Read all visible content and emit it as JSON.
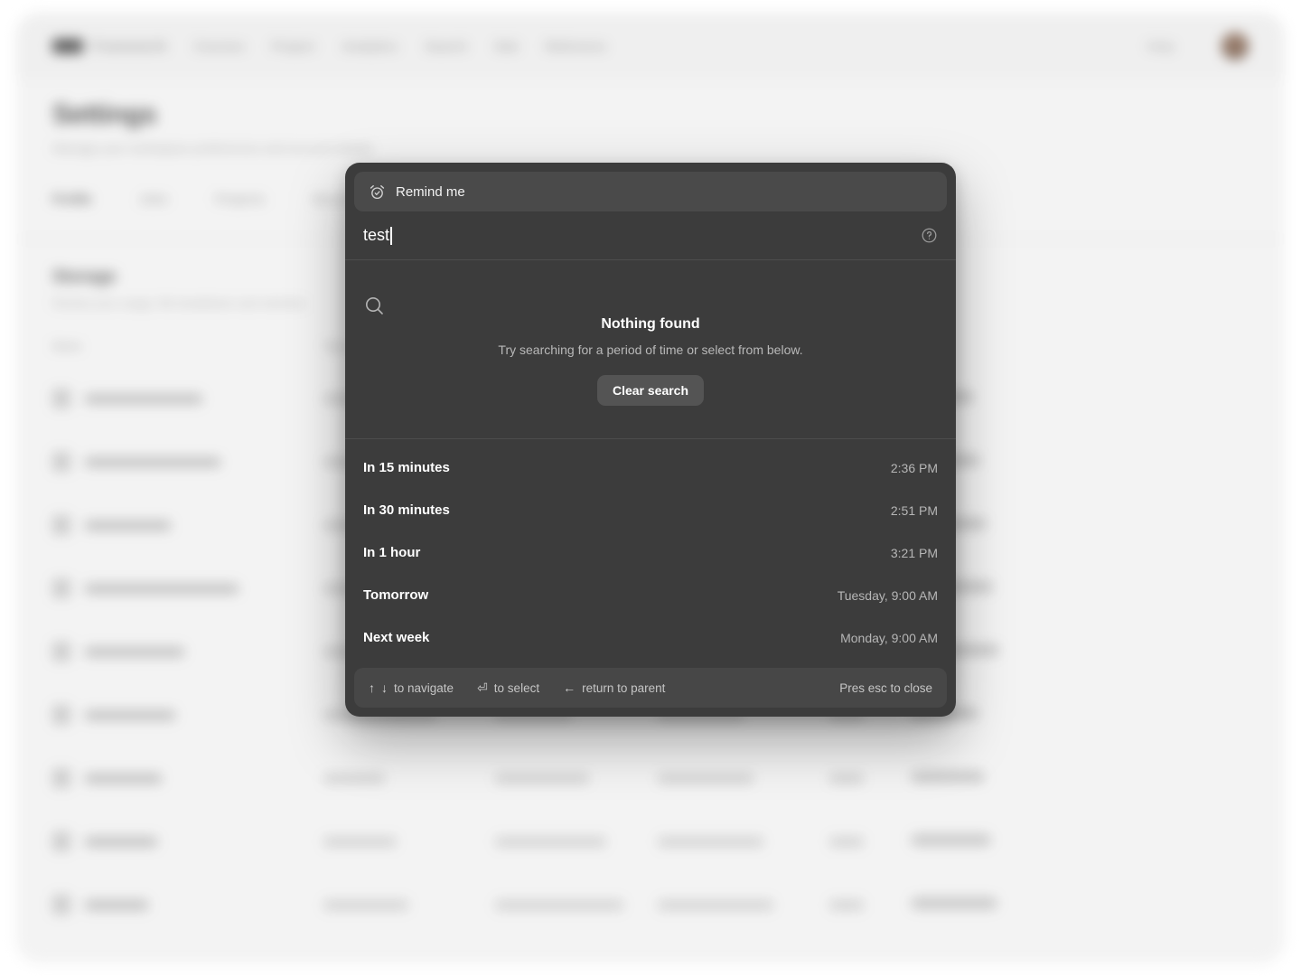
{
  "background": {
    "topbar": {
      "brand": "Framework",
      "nav": [
        "Courses",
        "Project",
        "Analytics",
        "Search",
        "Stat",
        "Reference"
      ],
      "action": "Help",
      "avatar": "user-avatar"
    },
    "page": {
      "title": "Settings",
      "subtitle": "Manage your workspace preferences and account details",
      "tabs": [
        "Profile",
        "Jobs",
        "Projects",
        "Security"
      ],
      "section_title": "Storage",
      "section_subtitle": "Review your usage, file breakdown and retention",
      "table": {
        "columns": [
          "Name",
          "Type",
          "Size",
          "Modified",
          "Role",
          "Status"
        ],
        "rows": [
          {
            "name": "Workspace",
            "type": "",
            "size": "",
            "modified": "",
            "role": "Owner",
            "status": "Active"
          },
          {
            "name": "Marketplace",
            "type": "",
            "size": "",
            "modified": "",
            "role": "Editor",
            "status": "Active"
          },
          {
            "name": "Database",
            "type": "",
            "size": "",
            "modified": "",
            "role": "Viewer",
            "status": "Archived"
          },
          {
            "name": "Documentation",
            "type": "",
            "size": "",
            "modified": "",
            "role": "Owner",
            "status": "Active"
          },
          {
            "name": "Reports",
            "type": "",
            "size": "",
            "modified": "",
            "role": "Editor",
            "status": "Pending"
          },
          {
            "name": "Assets",
            "type": "",
            "size": "",
            "modified": "",
            "role": "Viewer",
            "status": "Active"
          },
          {
            "name": "Images",
            "type": "",
            "size": "",
            "modified": "",
            "role": "Owner",
            "status": "Archived"
          },
          {
            "name": "Videos",
            "type": "",
            "size": "",
            "modified": "",
            "role": "Editor",
            "status": "Active"
          },
          {
            "name": "Logs",
            "type": "",
            "size": "",
            "modified": "",
            "role": "Viewer",
            "status": "Active"
          }
        ]
      }
    }
  },
  "modal": {
    "breadcrumb": {
      "icon": "alarm-check-icon",
      "label": "Remind me"
    },
    "search": {
      "value": "test",
      "placeholder": "",
      "help_icon": "help-circle-icon"
    },
    "empty_state": {
      "icon": "search-icon",
      "title": "Nothing found",
      "subtitle": "Try searching for a period of time or select from below.",
      "clear_button": "Clear search"
    },
    "suggestions": [
      {
        "label": "In 15 minutes",
        "time": "2:36 PM"
      },
      {
        "label": "In 30 minutes",
        "time": "2:51 PM"
      },
      {
        "label": "In 1 hour",
        "time": "3:21 PM"
      },
      {
        "label": "Tomorrow",
        "time": "Tuesday, 9:00 AM"
      },
      {
        "label": "Next week",
        "time": "Monday, 9:00 AM"
      }
    ],
    "footer": {
      "navigate_keys_up": "↑",
      "navigate_keys_down": "↓",
      "navigate_label": "to navigate",
      "select_key": "⏎",
      "select_label": "to select",
      "back_key": "←",
      "back_label": "return to parent",
      "close_label": "Pres esc to close"
    }
  },
  "colors": {
    "modal_bg": "#3c3c3c",
    "modal_inset": "#4a4a4a",
    "divider": "#4d4d4d",
    "text_primary": "#ffffff",
    "text_muted": "#b6b6b6"
  }
}
